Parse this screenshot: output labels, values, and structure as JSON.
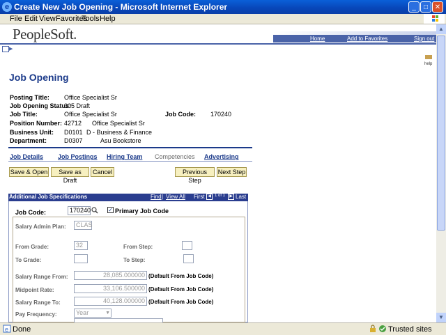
{
  "window": {
    "title": "Create New Job Opening - Microsoft Internet Explorer"
  },
  "menu": [
    "File",
    "Edit",
    "View",
    "Favorites",
    "Tools",
    "Help"
  ],
  "status": {
    "left": "Done",
    "zone": "Trusted sites"
  },
  "header": {
    "logo": "PeopleSoft.",
    "links": [
      "Home",
      "Add to Favorites",
      "Sign out"
    ],
    "help": "help"
  },
  "page": {
    "title": "Job Opening"
  },
  "fields": {
    "posting_title_label": "Posting Title:",
    "posting_title": "Office Specialist Sr",
    "status_label": "Job Opening Status:",
    "status": "005 Draft",
    "job_title_label": "Job Title:",
    "job_title": "Office Specialist Sr",
    "job_code_label": "Job Code:",
    "job_code": "170240",
    "position_label": "Position Number:",
    "position_number": "42712",
    "position_desc": "Office Specialist Sr",
    "bu_label": "Business Unit:",
    "bu_code": "D0101",
    "bu_desc": "D - Business & Finance",
    "dept_label": "Department:",
    "dept_code": "D0307",
    "dept_desc": "Asu Bookstore"
  },
  "tabs": [
    {
      "label": "Job Details",
      "active": true
    },
    {
      "label": "Job Postings",
      "active": true
    },
    {
      "label": "Hiring Team",
      "active": true
    },
    {
      "label": "Competencies",
      "active": false
    },
    {
      "label": "Advertising",
      "active": true
    }
  ],
  "buttons": {
    "save_open": "Save & Open",
    "save_draft": "Save as Draft",
    "cancel": "Cancel",
    "prev": "Previous Step",
    "next": "Next Step"
  },
  "section": {
    "title": "Additional Job Specifications",
    "find": "Find",
    "sep": " | ",
    "view_all": "View All",
    "first": "First",
    "count": "1 of 1",
    "last": "Last",
    "job_code_label": "Job Code:",
    "job_code": "170240",
    "primary_label": "Primary Job Code",
    "salary_plan_label": "Salary Admin Plan:",
    "salary_plan": "CLAS",
    "from_grade_label": "From Grade:",
    "from_grade": "32",
    "from_step_label": "From Step:",
    "to_grade_label": "To Grade:",
    "to_step_label": "To Step:",
    "range_from_label": "Salary Range From:",
    "range_from": "28,085.000000",
    "midpoint_label": "Midpoint Rate:",
    "midpoint": "33,106.500000",
    "range_to_label": "Salary Range To:",
    "range_to": "40,128.000000",
    "default_note": "(Default From Job Code)",
    "pay_freq_label": "Pay Frequency:",
    "pay_freq": "Year"
  }
}
